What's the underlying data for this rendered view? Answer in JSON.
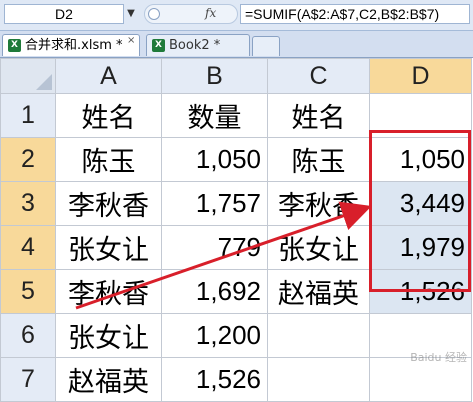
{
  "formula_bar": {
    "name_box": "D2",
    "name_box_arrow": "▼",
    "fx_label": "fx",
    "formula": "=SUMIF(A$2:A$7,C2,B$2:B$7)"
  },
  "tabs": [
    {
      "label": "合并求和.xlsm *",
      "icon": "X",
      "close": "×"
    },
    {
      "label": "Book2 *",
      "icon": "X",
      "close": ""
    }
  ],
  "grid": {
    "columns": [
      "A",
      "B",
      "C",
      "D"
    ],
    "rows": [
      {
        "num": "1",
        "a": "姓名",
        "b": "数量",
        "c": "姓名",
        "d": ""
      },
      {
        "num": "2",
        "a": "陈玉",
        "b": "1,050",
        "c": "陈玉",
        "d": "1,050"
      },
      {
        "num": "3",
        "a": "李秋香",
        "b": "1,757",
        "c": "李秋香",
        "d": "3,449"
      },
      {
        "num": "4",
        "a": "张女让",
        "b": "779",
        "c": "张女让",
        "d": "1,979"
      },
      {
        "num": "5",
        "a": "李秋香",
        "b": "1,692",
        "c": "赵福英",
        "d": "1,526"
      },
      {
        "num": "6",
        "a": "张女让",
        "b": "1,200",
        "c": "",
        "d": ""
      },
      {
        "num": "7",
        "a": "赵福英",
        "b": "1,526",
        "c": "",
        "d": ""
      }
    ],
    "selected_column": "D",
    "selected_rows": [
      "2",
      "3",
      "4",
      "5"
    ]
  },
  "annotation": {
    "box_color": "#d81f2a",
    "arrow_color": "#d81f2a"
  },
  "watermark": "Baidu 经验"
}
